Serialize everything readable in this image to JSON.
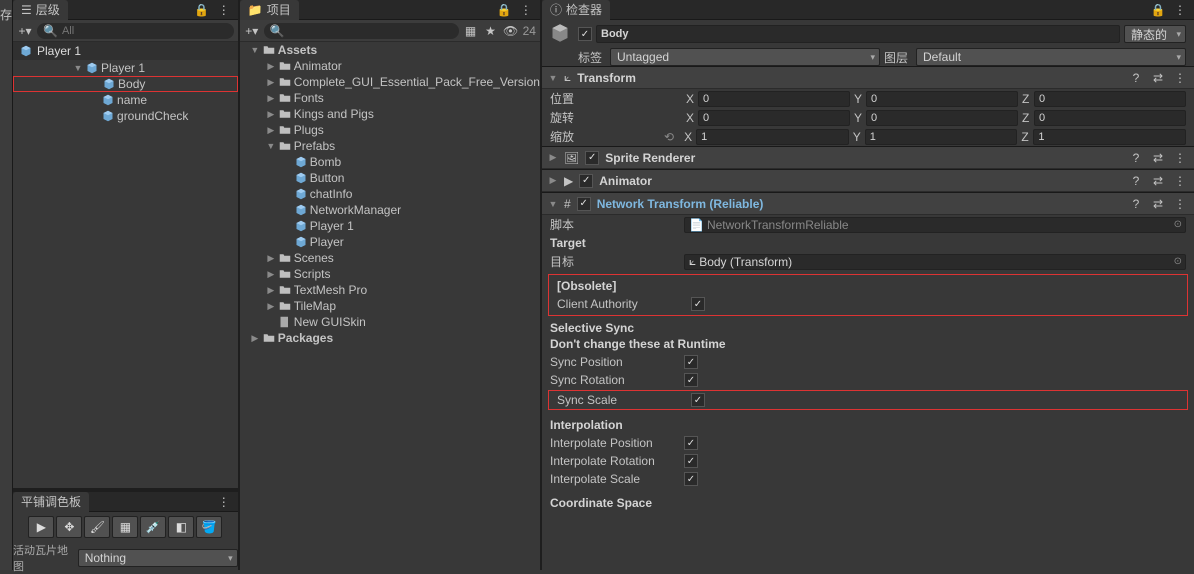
{
  "hierarchy": {
    "title": "层级",
    "search_placeholder": "All",
    "root": "Player 1",
    "nodes": [
      {
        "name": "Player 1",
        "depth": 0,
        "type": "prefab",
        "expanded": true
      },
      {
        "name": "Body",
        "depth": 1,
        "type": "prefab",
        "highlight": true
      },
      {
        "name": "name",
        "depth": 1,
        "type": "prefab"
      },
      {
        "name": "groundCheck",
        "depth": 1,
        "type": "prefab"
      }
    ]
  },
  "palette": {
    "title": "平铺调色板",
    "active_label": "活动瓦片地图",
    "dropdown_value": "Nothing"
  },
  "project": {
    "title": "项目",
    "count": "24",
    "tree": [
      {
        "name": "Assets",
        "depth": 0,
        "type": "folder",
        "expanded": true
      },
      {
        "name": "Animator",
        "depth": 1,
        "type": "folder"
      },
      {
        "name": "Complete_GUI_Essential_Pack_Free_Version",
        "depth": 1,
        "type": "folder"
      },
      {
        "name": "Fonts",
        "depth": 1,
        "type": "folder"
      },
      {
        "name": "Kings and Pigs",
        "depth": 1,
        "type": "folder"
      },
      {
        "name": "Plugs",
        "depth": 1,
        "type": "folder"
      },
      {
        "name": "Prefabs",
        "depth": 1,
        "type": "folder",
        "expanded": true
      },
      {
        "name": "Bomb",
        "depth": 2,
        "type": "prefab"
      },
      {
        "name": "Button",
        "depth": 2,
        "type": "prefab"
      },
      {
        "name": "chatInfo",
        "depth": 2,
        "type": "prefab"
      },
      {
        "name": "NetworkManager",
        "depth": 2,
        "type": "prefab"
      },
      {
        "name": "Player 1",
        "depth": 2,
        "type": "prefab"
      },
      {
        "name": "Player",
        "depth": 2,
        "type": "prefab"
      },
      {
        "name": "Scenes",
        "depth": 1,
        "type": "folder"
      },
      {
        "name": "Scripts",
        "depth": 1,
        "type": "folder"
      },
      {
        "name": "TextMesh Pro",
        "depth": 1,
        "type": "folder"
      },
      {
        "name": "TileMap",
        "depth": 1,
        "type": "folder"
      },
      {
        "name": "New GUISkin",
        "depth": 1,
        "type": "asset"
      },
      {
        "name": "Packages",
        "depth": 0,
        "type": "folder"
      }
    ]
  },
  "inspector": {
    "title": "检查器",
    "name": "Body",
    "static_label": "静态的",
    "tag_label": "标签",
    "tag_value": "Untagged",
    "layer_label": "图层",
    "layer_value": "Default",
    "transform": {
      "title": "Transform",
      "pos_label": "位置",
      "rot_label": "旋转",
      "scale_label": "缩放",
      "pos": {
        "x": "0",
        "y": "0",
        "z": "0"
      },
      "rot": {
        "x": "0",
        "y": "0",
        "z": "0"
      },
      "scale": {
        "x": "1",
        "y": "1",
        "z": "1"
      }
    },
    "sprite_renderer": {
      "title": "Sprite Renderer"
    },
    "animator": {
      "title": "Animator"
    },
    "net_transform": {
      "title": "Network Transform (Reliable)",
      "script_label": "脚本",
      "script_value": "NetworkTransformReliable",
      "target_header": "Target",
      "target_label": "目标",
      "target_value": "Body (Transform)",
      "obsolete_header": "[Obsolete]",
      "client_auth_label": "Client Authority",
      "selective_sync_header": "Selective Sync",
      "selective_sync_sub": "Don't change these at Runtime",
      "sync_pos_label": "Sync Position",
      "sync_rot_label": "Sync Rotation",
      "sync_scale_label": "Sync Scale",
      "interp_header": "Interpolation",
      "interp_pos_label": "Interpolate Position",
      "interp_rot_label": "Interpolate Rotation",
      "interp_scale_label": "Interpolate Scale",
      "coord_header": "Coordinate Space"
    }
  },
  "left_strip": "存"
}
